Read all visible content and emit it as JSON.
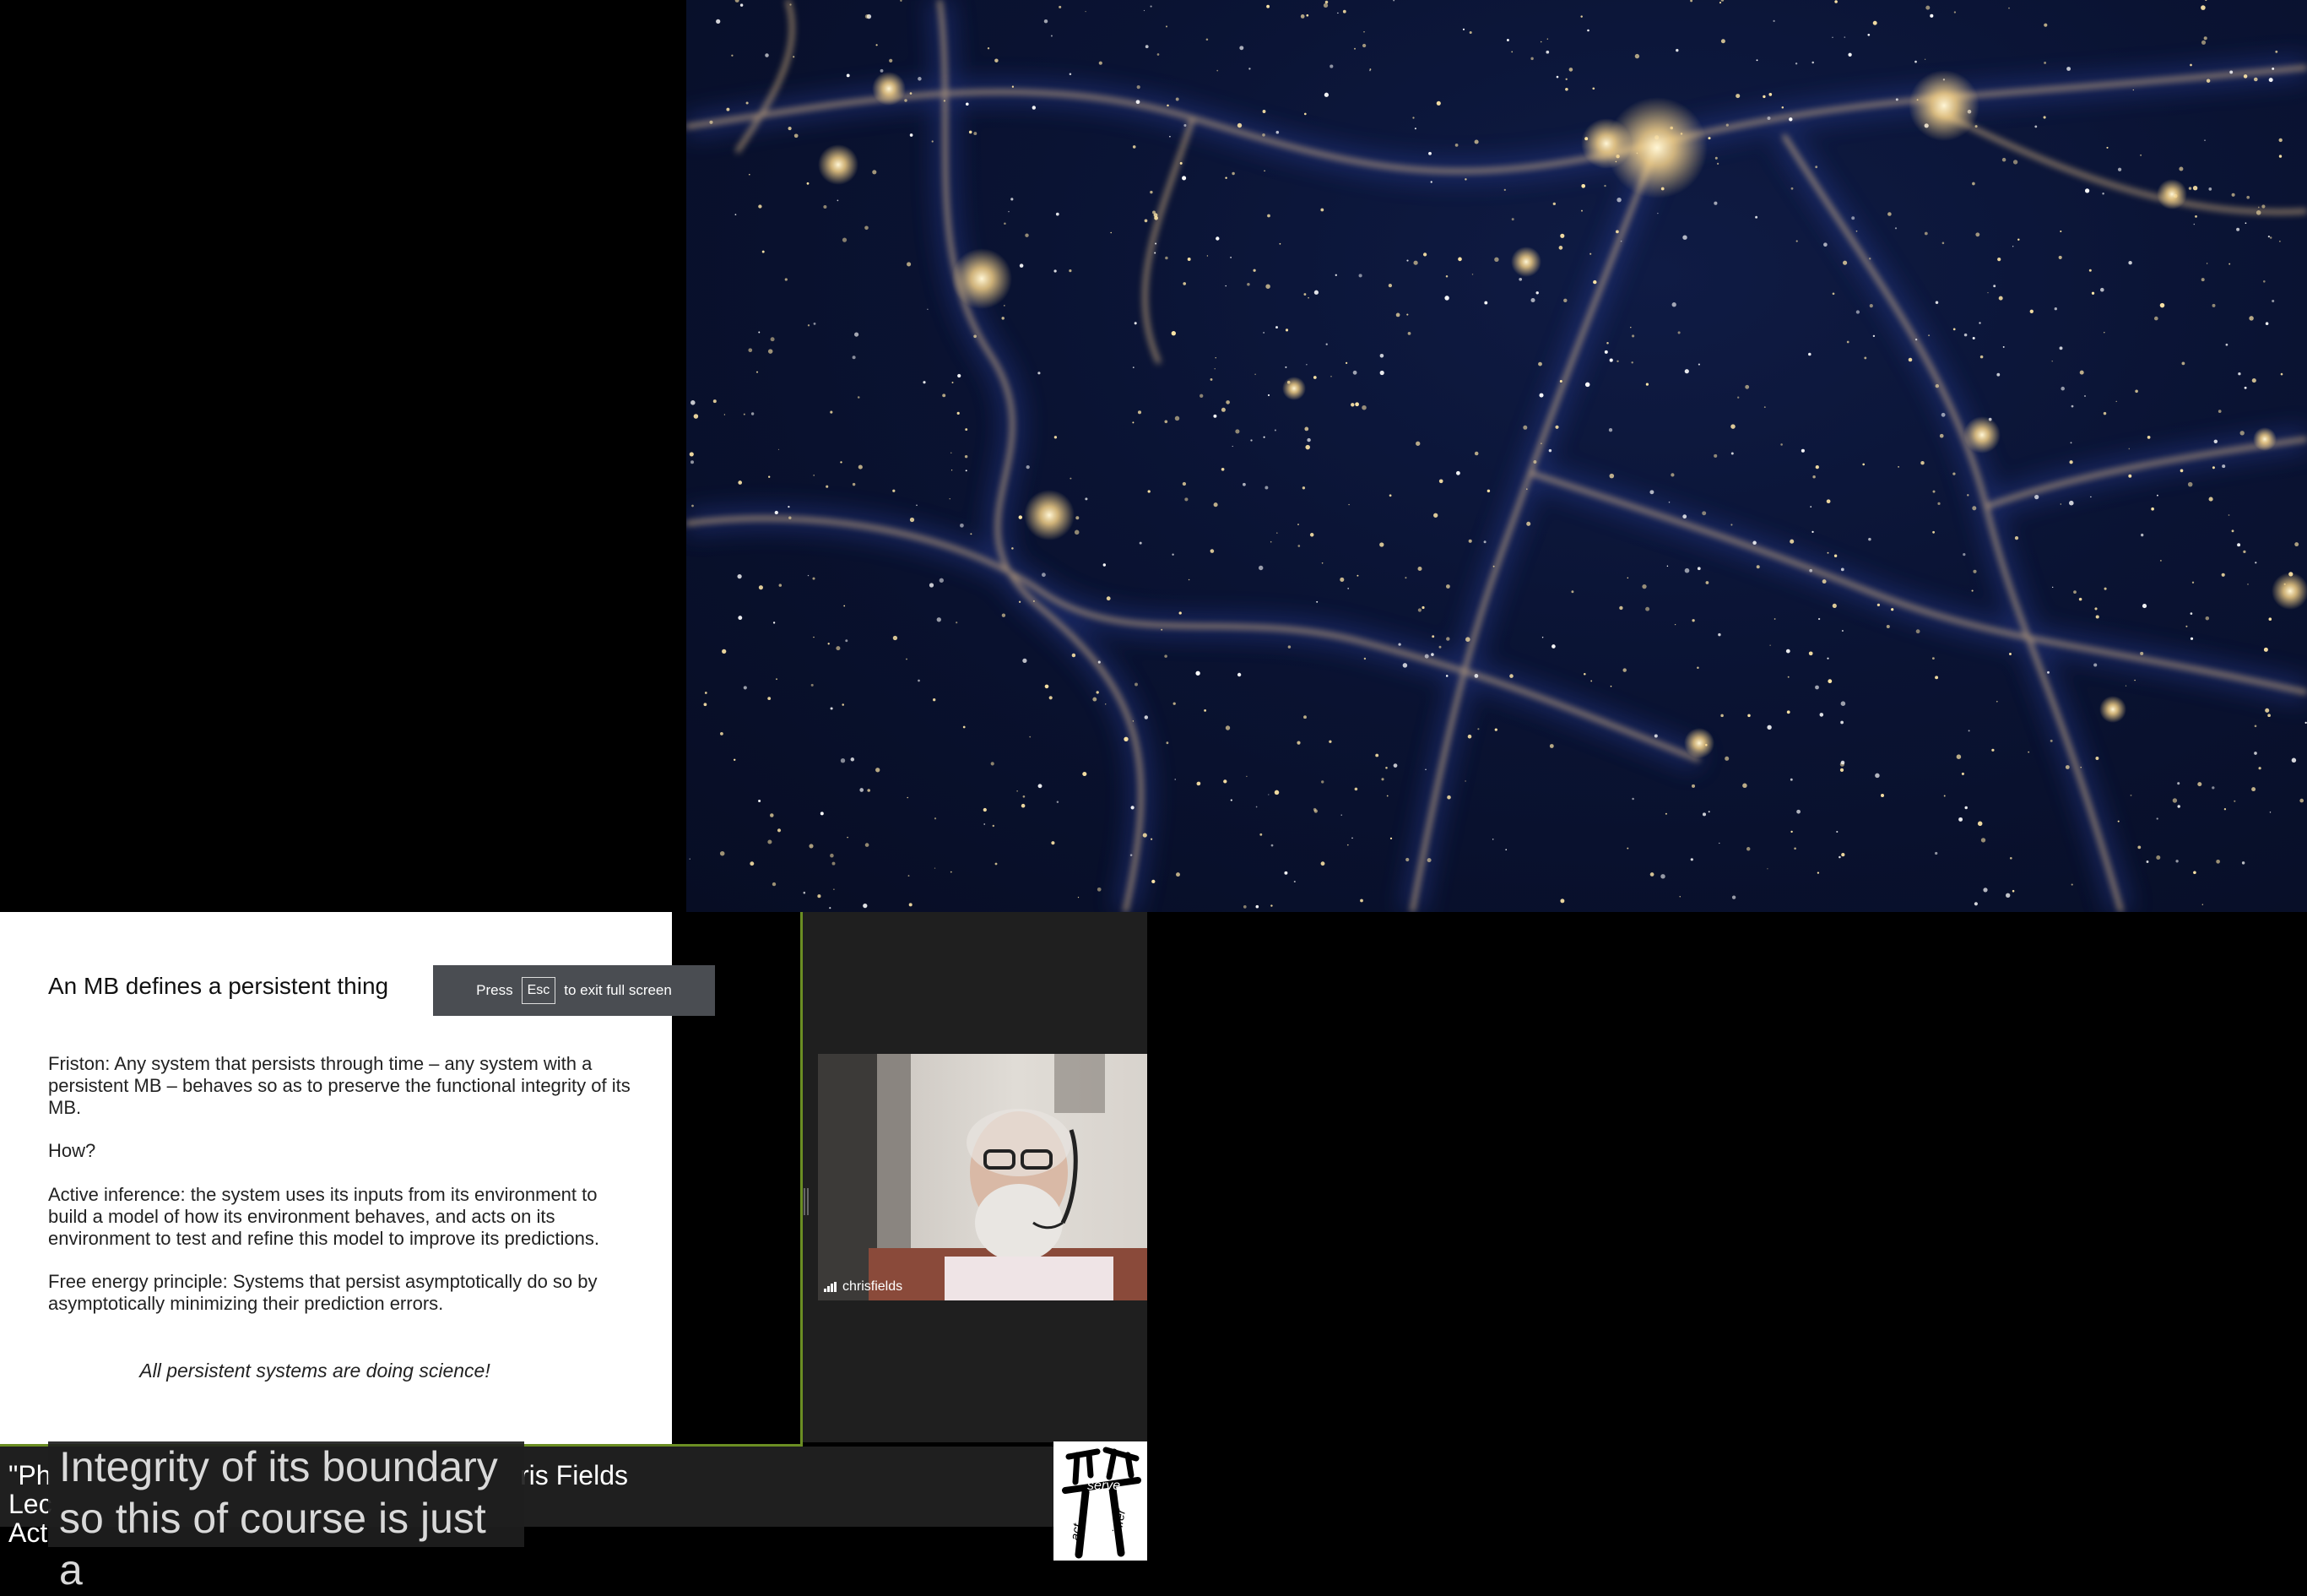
{
  "slide": {
    "title": "An MB defines a persistent thing",
    "paragraphs": [
      "Friston: Any system that persists through time – any system with a persistent MB – behaves so as to preserve the functional integrity of its MB.",
      "How?",
      "Active inference: the system uses its inputs from its environment to build a model of how its environment behaves, and acts on its environment to test and refine this model to improve its predictions.",
      "Free energy principle: Systems that persist asymptotically do so by asymptotically minimizing their prediction errors."
    ],
    "emphasis": "All persistent systems are doing science!"
  },
  "fullscreen_hint": {
    "prefix": "Press",
    "key": "Esc",
    "suffix": "to exit full screen"
  },
  "participant": {
    "name": "chrisfields"
  },
  "stream_title": {
    "line1": "\"Ph",
    "line1_tail": "ris Fields",
    "line2": "Lec",
    "line3": "Act"
  },
  "captions": {
    "line1": "Integrity of its boundary",
    "line2": "so this of course is just a"
  },
  "logo": {
    "top_text": "serve",
    "left_text": "act",
    "right_text": "infer"
  },
  "colors": {
    "slide_background": "#ffffff",
    "accent_border": "#6b8e23",
    "panel_background": "#1f1f1f",
    "cosmic_background": "#0a1333",
    "galaxy_glow": "#ffd98a"
  }
}
